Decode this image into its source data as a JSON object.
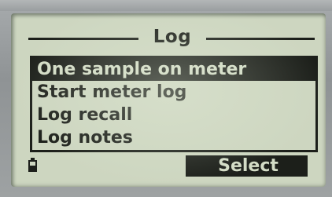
{
  "screen": {
    "title": "Log",
    "menu_items": [
      {
        "label": "One sample on meter",
        "selected": true
      },
      {
        "label": "Start meter log",
        "selected": false
      },
      {
        "label": "Log recall",
        "selected": false
      },
      {
        "label": "Log notes",
        "selected": false
      }
    ],
    "softkey": {
      "label": "Select"
    },
    "status": {
      "battery_icon": "battery-icon"
    },
    "colors": {
      "lcd_background": "#cdd6c0",
      "lcd_ink": "#1c1f1a",
      "bezel": "#9a9ea0"
    }
  }
}
